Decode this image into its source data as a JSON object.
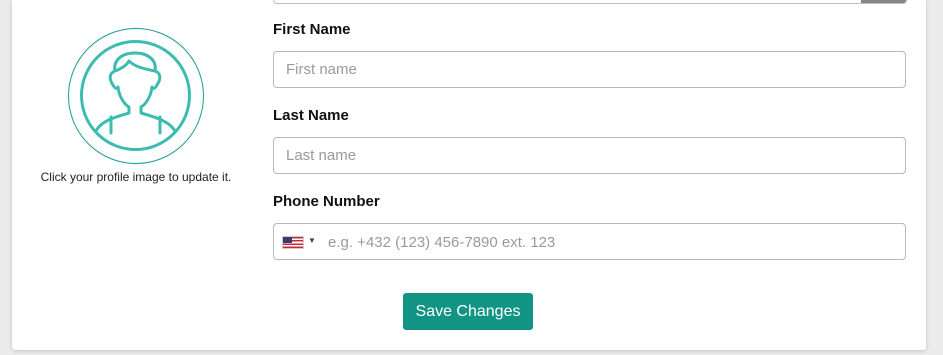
{
  "profile": {
    "avatar_icon": "user-avatar-icon",
    "hint": "Click your profile image to update it.",
    "accent_color": "#1a9e8f"
  },
  "form": {
    "first_name": {
      "label": "First Name",
      "placeholder": "First name",
      "value": ""
    },
    "last_name": {
      "label": "Last Name",
      "placeholder": "Last name",
      "value": ""
    },
    "phone": {
      "label": "Phone Number",
      "country_flag_icon": "us-flag-icon",
      "placeholder": "e.g. +432 (123) 456-7890 ext. 123",
      "value": ""
    },
    "save_label": "Save Changes",
    "save_color": "#129484"
  }
}
